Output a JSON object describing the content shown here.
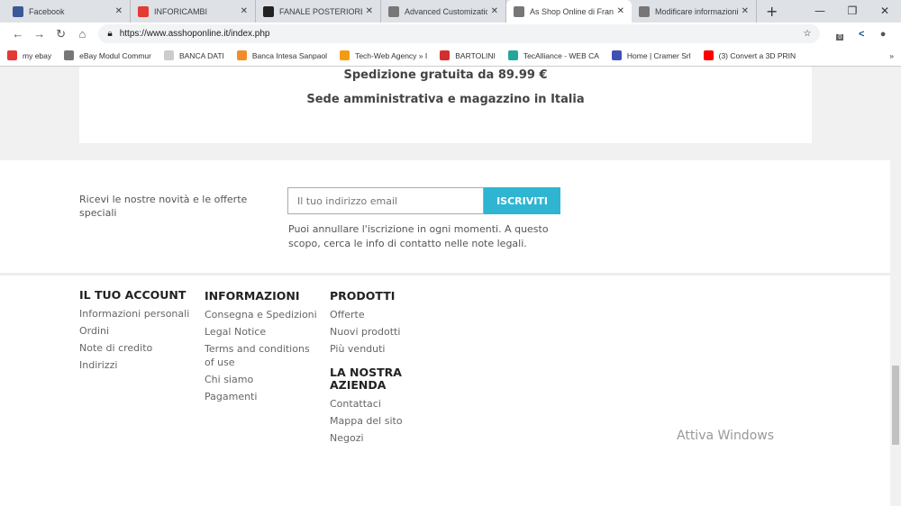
{
  "browser": {
    "tabs": [
      {
        "title": "Facebook",
        "color": "#3b5998"
      },
      {
        "title": "INFORICAMBI",
        "color": "#e53935"
      },
      {
        "title": "FANALE POSTERIORE M",
        "color": "#222"
      },
      {
        "title": "Advanced Customizatio",
        "color": "#777"
      },
      {
        "title": "As Shop Online di Franc",
        "color": "#777"
      },
      {
        "title": "Modificare informazioni",
        "color": "#777"
      }
    ],
    "url": "https://www.asshoponline.it/index.php",
    "bookmarks": [
      {
        "label": "my ebay",
        "color": "#e53935"
      },
      {
        "label": "eBay Modul Commur",
        "color": "#777"
      },
      {
        "label": "BANCA DATI",
        "color": "#ccc"
      },
      {
        "label": "Banca Intesa Sanpaol",
        "color": "#f28c28"
      },
      {
        "label": "Tech-Web Agency » I",
        "color": "#f39c12"
      },
      {
        "label": "BARTOLINI",
        "color": "#d32f2f"
      },
      {
        "label": "TecAlliance - WEB CA",
        "color": "#26a69a"
      },
      {
        "label": "Home | Cramer Srl",
        "color": "#3f51b5"
      },
      {
        "label": "(3) Convert a 3D PRIN",
        "color": "#ff0000"
      }
    ],
    "ext_badge": "0"
  },
  "banner": {
    "line1": "Spedizione gratuita da 89.99 €",
    "line2": "Sede amministrativa e magazzino in Italia"
  },
  "newsletter": {
    "label": "Ricevi le nostre novità e le offerte speciali",
    "placeholder": "Il tuo indirizzo email",
    "button": "ISCRIVITI",
    "note": "Puoi annullare l'iscrizione in ogni momenti. A questo scopo, cerca le info di contatto nelle note legali."
  },
  "footer": {
    "account": {
      "title": "IL TUO ACCOUNT",
      "links": [
        "Informazioni personali",
        "Ordini",
        "Note di credito",
        "Indirizzi"
      ]
    },
    "info": {
      "title": "INFORMAZIONI",
      "links": [
        "Consegna e Spedizioni",
        "Legal Notice",
        "Terms and conditions of use",
        "Chi siamo",
        "Pagamenti"
      ]
    },
    "products": {
      "title": "PRODOTTI",
      "links": [
        "Offerte",
        "Nuovi prodotti",
        "Più venduti"
      ]
    },
    "company": {
      "title": "LA NOSTRA AZIENDA",
      "links": [
        "Contattaci",
        "Mappa del sito",
        "Negozi"
      ]
    }
  },
  "watermark": "Attiva Windows"
}
